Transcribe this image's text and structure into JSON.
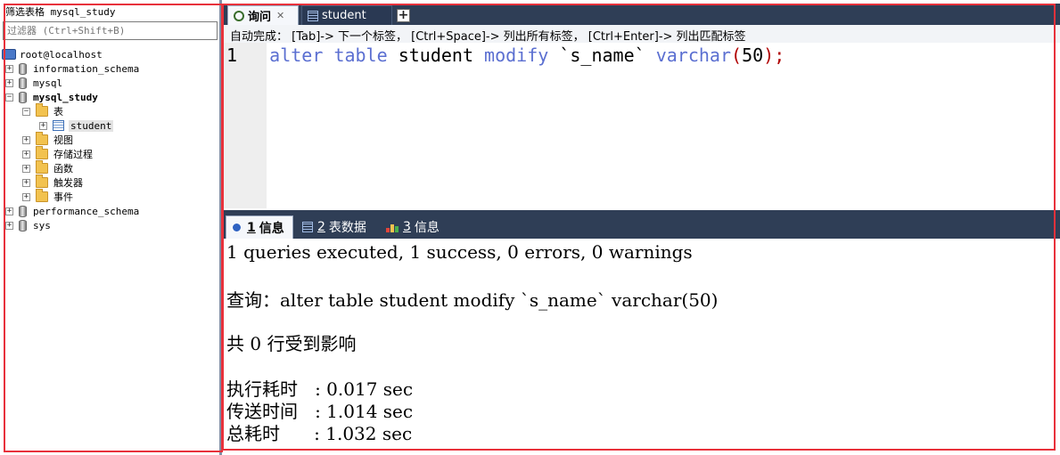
{
  "left_panel": {
    "filter_title": "筛选表格 mysql_study",
    "filter_placeholder": "过滤器 (Ctrl+Shift+B)",
    "tree": {
      "server": "root@localhost",
      "databases": [
        "information_schema",
        "mysql",
        "mysql_study",
        "performance_schema",
        "sys"
      ],
      "mysql_study_children": {
        "tables_folder": "表",
        "table": "student",
        "views": "视图",
        "procedures": "存储过程",
        "functions": "函数",
        "triggers": "触发器",
        "events": "事件"
      }
    }
  },
  "top_tabs": {
    "query": "询问",
    "student": "student"
  },
  "autocomplete_hint": "自动完成： [Tab]-> 下一个标签， [Ctrl+Space]-> 列出所有标签， [Ctrl+Enter]-> 列出匹配标签",
  "editor": {
    "line_number": "1",
    "tokens": {
      "alter": "alter",
      "table": "table",
      "student": "student",
      "modify": "modify",
      "col": "`s_name`",
      "varchar": "varchar",
      "lp": "(",
      "num": "50",
      "rp": ");"
    }
  },
  "result_tabs": {
    "info1_num": "1",
    "info1_label": "信息",
    "tabledata_num": "2",
    "tabledata_label": "表数据",
    "info3_num": "3",
    "info3_label": "信息"
  },
  "messages": {
    "summary": "1 queries executed, 1 success, 0 errors, 0 warnings",
    "query": "查询：alter table student modify `s_name` varchar(50)",
    "affected": "共 0 行受到影响",
    "exec_time": "执行耗时   : 0.017 sec",
    "transfer_time": "传送时间   : 1.014 sec",
    "total_time": "总耗时      : 1.032 sec"
  }
}
